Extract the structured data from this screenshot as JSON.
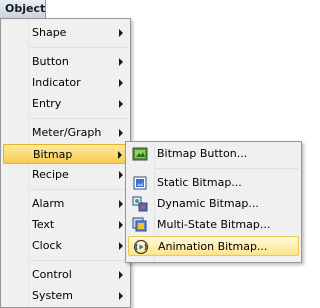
{
  "menubar": {
    "object_label": "Object"
  },
  "main_menu": {
    "items": [
      {
        "label": "Shape",
        "submenu": true
      },
      {
        "label": "Button",
        "submenu": true
      },
      {
        "label": "Indicator",
        "submenu": true
      },
      {
        "label": "Entry",
        "submenu": true
      },
      {
        "label": "Meter/Graph",
        "submenu": true
      },
      {
        "label": "Bitmap",
        "submenu": true,
        "state": "highlighted"
      },
      {
        "label": "Recipe",
        "submenu": true
      },
      {
        "label": "Alarm",
        "submenu": true
      },
      {
        "label": "Text",
        "submenu": true
      },
      {
        "label": "Clock",
        "submenu": true
      },
      {
        "label": "Control",
        "submenu": true
      },
      {
        "label": "System",
        "submenu": true
      }
    ]
  },
  "bitmap_submenu": {
    "items": [
      {
        "label": "Bitmap Button...",
        "icon": "bitmap-button-icon"
      },
      {
        "label": "Static Bitmap...",
        "icon": "static-bitmap-icon"
      },
      {
        "label": "Dynamic Bitmap...",
        "icon": "dynamic-bitmap-icon"
      },
      {
        "label": "Multi-State Bitmap...",
        "icon": "multi-state-bitmap-icon"
      },
      {
        "label": "Animation Bitmap...",
        "icon": "animation-bitmap-icon",
        "state": "hovered"
      }
    ]
  },
  "colors": {
    "highlight": "#f9cc52",
    "menu_bg": "#f0f0f0",
    "border": "#979797"
  }
}
